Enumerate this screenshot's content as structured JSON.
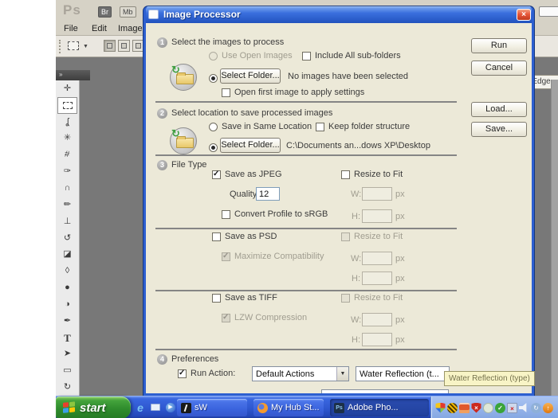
{
  "photoshop": {
    "logo": "Ps",
    "bridge_button": "Br",
    "mobile_button": "Mb",
    "menu": [
      "File",
      "Edit",
      "Image"
    ],
    "tools_header_glyph": "»",
    "options_bar": {
      "refine_edge_fragment": "e Edge..."
    },
    "tools": [
      {
        "name": "move-tool",
        "glyph": "✛"
      },
      {
        "name": "rectangular-marquee-tool",
        "glyph": "",
        "selected": true
      },
      {
        "name": "lasso-tool",
        "glyph": "ʆ"
      },
      {
        "name": "quick-selection-tool",
        "glyph": "✳"
      },
      {
        "name": "crop-tool",
        "glyph": "#"
      },
      {
        "name": "eyedropper-tool",
        "glyph": "✑"
      },
      {
        "name": "healing-brush-tool",
        "glyph": "∩"
      },
      {
        "name": "brush-tool",
        "glyph": "✏"
      },
      {
        "name": "clone-stamp-tool",
        "glyph": "⊥"
      },
      {
        "name": "history-brush-tool",
        "glyph": "↺"
      },
      {
        "name": "eraser-tool",
        "glyph": "◪"
      },
      {
        "name": "paint-bucket-tool",
        "glyph": "◊"
      },
      {
        "name": "blur-tool",
        "glyph": "●"
      },
      {
        "name": "burn-tool",
        "glyph": "◑"
      },
      {
        "name": "pen-tool",
        "glyph": "✒"
      },
      {
        "name": "type-tool",
        "glyph": "T"
      },
      {
        "name": "path-selection-tool",
        "glyph": "➤"
      },
      {
        "name": "rectangle-tool",
        "glyph": "▭"
      },
      {
        "name": "rotate-view-tool",
        "glyph": "↻"
      }
    ]
  },
  "dialog": {
    "title": "Image Processor",
    "close_glyph": "×",
    "buttons": {
      "run": "Run",
      "cancel": "Cancel",
      "load": "Load...",
      "save": "Save..."
    },
    "units": {
      "w": "W:",
      "h": "H:",
      "px": "px"
    },
    "section1": {
      "number": "1",
      "title": "Select the images to process",
      "use_open_images": "Use Open Images",
      "include_subfolders": "Include All sub-folders",
      "select_folder": "Select Folder...",
      "status": "No images have been selected",
      "open_first": "Open first image to apply settings"
    },
    "section2": {
      "number": "2",
      "title": "Select location to save processed images",
      "save_in_same": "Save in Same Location",
      "keep_structure": "Keep folder structure",
      "select_folder": "Select Folder...",
      "path": "C:\\Documents an...dows XP\\Desktop"
    },
    "section3": {
      "number": "3",
      "title": "File Type",
      "jpeg": {
        "label": "Save as JPEG",
        "quality_label": "Quality:",
        "quality_value": "12",
        "convert_label": "Convert Profile to sRGB",
        "resize_label": "Resize to Fit"
      },
      "psd": {
        "label": "Save as PSD",
        "maximize_label": "Maximize Compatibility",
        "resize_label": "Resize to Fit"
      },
      "tiff": {
        "label": "Save as TIFF",
        "lzw_label": "LZW Compression",
        "resize_label": "Resize to Fit"
      }
    },
    "section4": {
      "number": "4",
      "title": "Preferences",
      "run_action_label": "Run Action:",
      "action_set": "Default Actions",
      "action_name": "Water Reflection (t..."
    }
  },
  "tooltip": {
    "text": "Water Reflection (type)"
  },
  "taskbar": {
    "start_label": "start",
    "quick_launch": [
      {
        "name": "internet-explorer-icon"
      },
      {
        "name": "show-desktop-icon"
      },
      {
        "name": "media-player-icon"
      }
    ],
    "buttons": [
      {
        "label": "sW"
      },
      {
        "label": "My Hub St..."
      },
      {
        "label": "Adobe Pho...",
        "active": true
      }
    ],
    "tray_icons": [
      {
        "name": "security-center-shield-icon"
      },
      {
        "name": "antispyware-icon"
      },
      {
        "name": "program-alert-icon"
      },
      {
        "name": "security-alert-shield-icon"
      },
      {
        "name": "status-circle-icon"
      },
      {
        "name": "safely-remove-hardware-icon"
      },
      {
        "name": "network-disconnected-icon"
      },
      {
        "name": "volume-icon"
      },
      {
        "name": "updates-sync-icon"
      },
      {
        "name": "update-available-icon"
      }
    ]
  }
}
